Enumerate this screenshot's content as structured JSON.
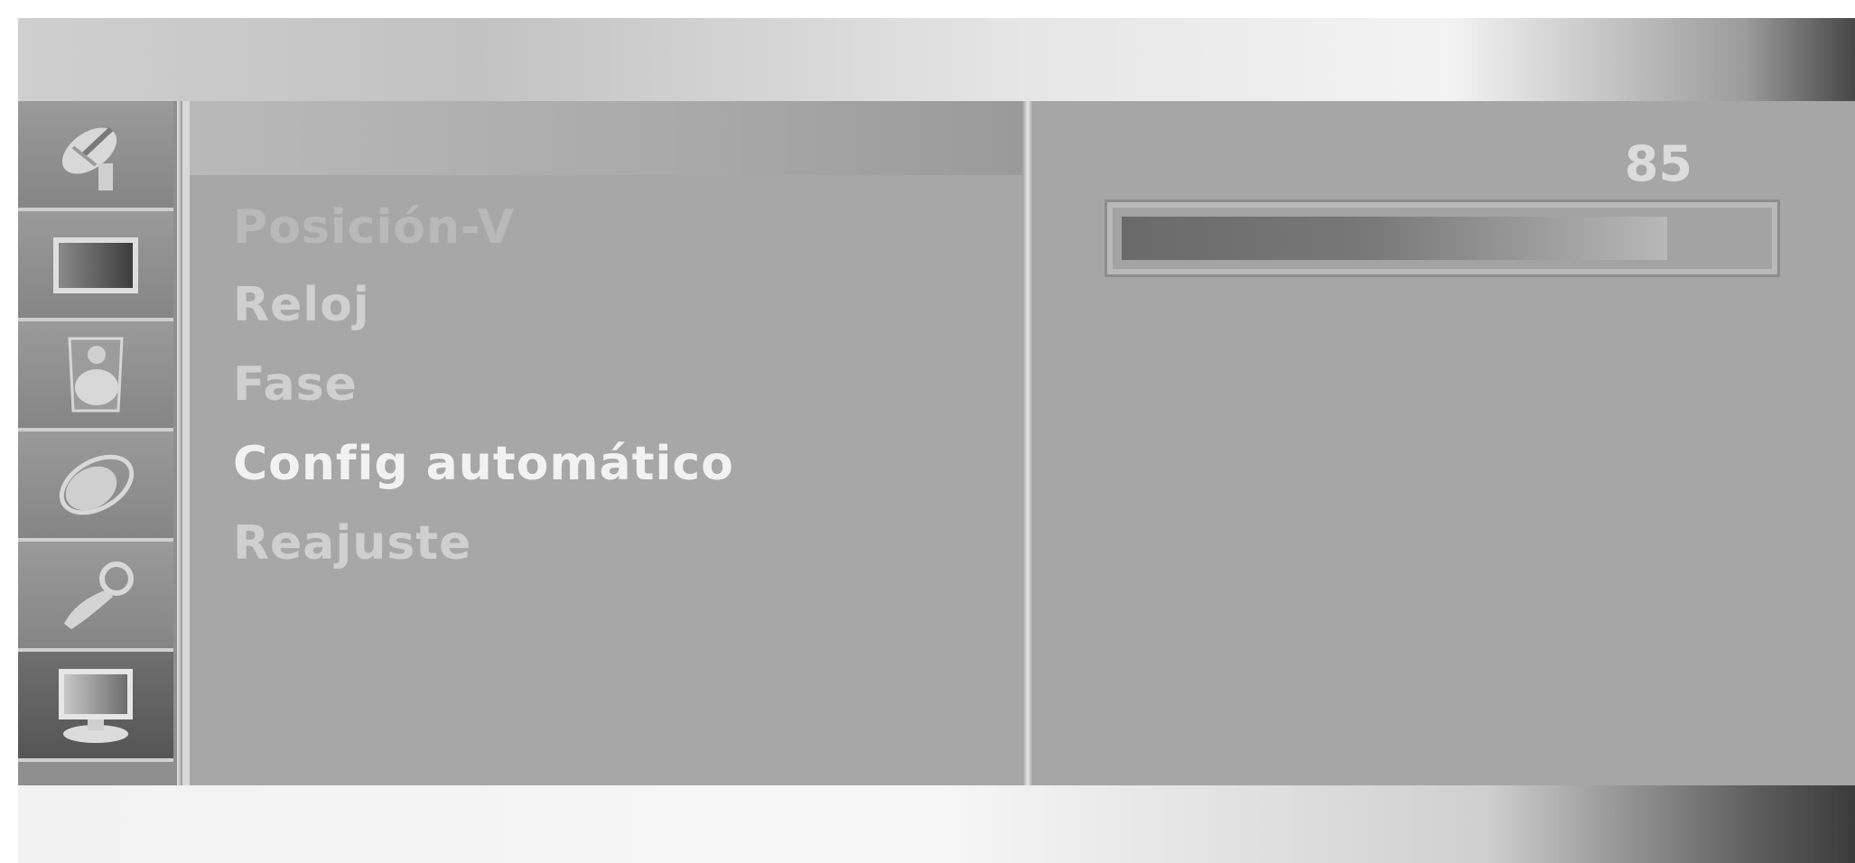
{
  "sidebar": {
    "items": [
      {
        "icon": "satellite-dish-icon",
        "active": false
      },
      {
        "icon": "picture-screen-icon",
        "active": false
      },
      {
        "icon": "audio-speaker-icon",
        "active": false
      },
      {
        "icon": "clock-dial-icon",
        "active": false
      },
      {
        "icon": "key-lock-icon",
        "active": false
      },
      {
        "icon": "monitor-screen-icon",
        "active": true
      }
    ]
  },
  "menu": {
    "items": [
      {
        "label": "Posición-V",
        "state": "faded"
      },
      {
        "label": "Reloj",
        "state": "normal"
      },
      {
        "label": "Fase",
        "state": "normal"
      },
      {
        "label": "Config automático",
        "state": "selected"
      },
      {
        "label": "Reajuste",
        "state": "normal"
      }
    ]
  },
  "value_panel": {
    "value": "85",
    "fill_fraction": 0.85
  }
}
